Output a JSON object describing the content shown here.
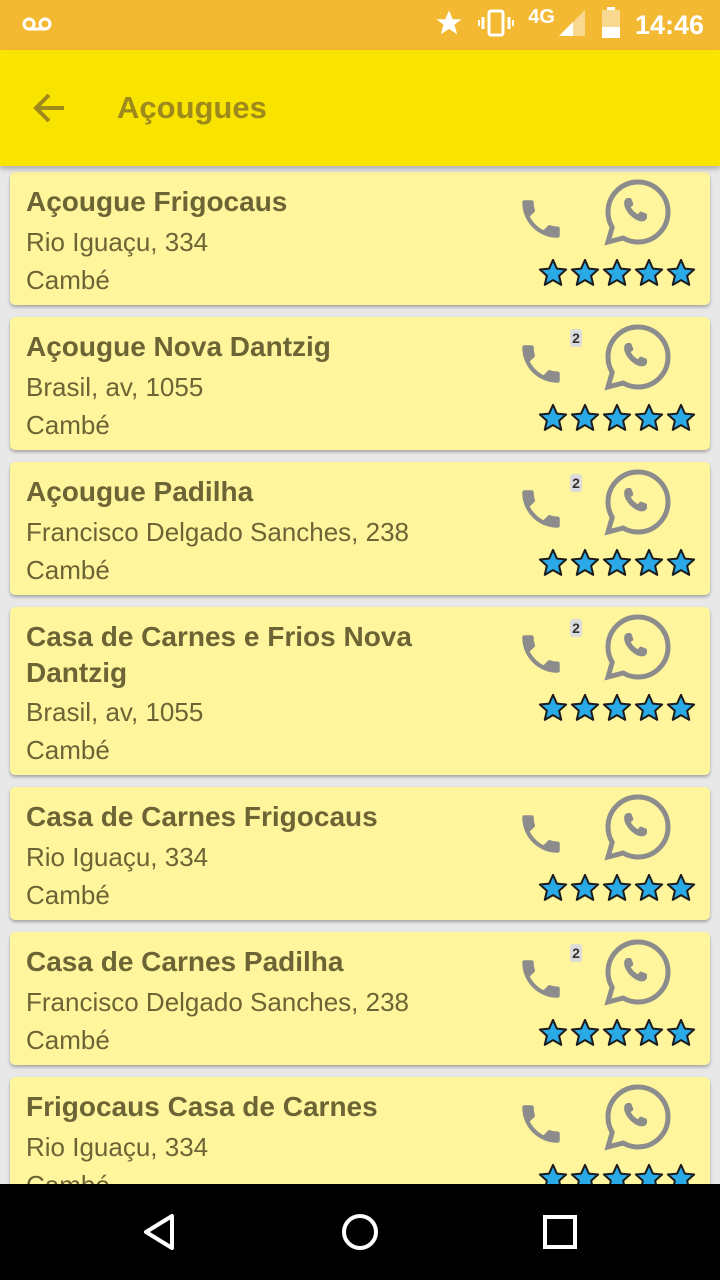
{
  "status_bar": {
    "time": "14:46",
    "network": "4G",
    "icons": [
      "voicemail-icon",
      "star-icon",
      "vibrate-icon",
      "signal-icon",
      "battery-icon"
    ]
  },
  "app_bar": {
    "title": "Açougues",
    "back_icon": "arrow-left-icon"
  },
  "colors": {
    "status_bar": "#f4b933",
    "app_bar": "#f9e300",
    "card": "#fff59d",
    "text": "#6d6436",
    "star_fill": "#29a9e6",
    "icon_gray": "#8c8c8c"
  },
  "listings": [
    {
      "name": "Açougue Frigocaus",
      "address": "Rio Iguaçu, 334",
      "city": "Cambé",
      "phone_badge": "",
      "rating": 5
    },
    {
      "name": "Açougue Nova Dantzig",
      "address": "Brasil, av, 1055",
      "city": "Cambé",
      "phone_badge": "2",
      "rating": 5
    },
    {
      "name": "Açougue Padilha",
      "address": "Francisco Delgado Sanches, 238",
      "city": "Cambé",
      "phone_badge": "2",
      "rating": 5
    },
    {
      "name": "Casa de Carnes e Frios Nova Dantzig",
      "address": "Brasil, av, 1055",
      "city": "Cambé",
      "phone_badge": "2",
      "rating": 5
    },
    {
      "name": "Casa de Carnes Frigocaus",
      "address": "Rio Iguaçu, 334",
      "city": "Cambé",
      "phone_badge": "",
      "rating": 5
    },
    {
      "name": "Casa de Carnes Padilha",
      "address": "Francisco Delgado Sanches, 238",
      "city": "Cambé",
      "phone_badge": "2",
      "rating": 5
    },
    {
      "name": "Frigocaus Casa de Carnes",
      "address": "Rio Iguaçu, 334",
      "city": "Cambé",
      "phone_badge": "",
      "rating": 5
    }
  ],
  "nav_bar": {
    "buttons": [
      "back-triangle-icon",
      "home-circle-icon",
      "recents-square-icon"
    ]
  }
}
